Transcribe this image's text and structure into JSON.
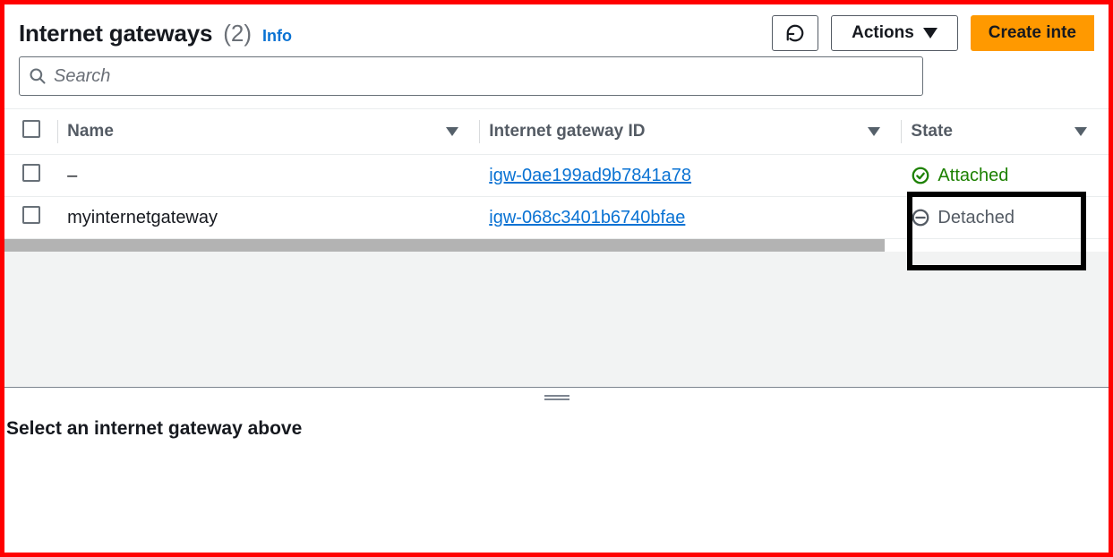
{
  "header": {
    "title": "Internet gateways",
    "count": "(2)",
    "info": "Info",
    "actions": "Actions",
    "create": "Create inte"
  },
  "search": {
    "placeholder": "Search"
  },
  "columns": {
    "name": "Name",
    "id": "Internet gateway ID",
    "state": "State"
  },
  "rows": [
    {
      "name": "–",
      "id": "igw-0ae199ad9b7841a78",
      "state": "Attached",
      "state_kind": "attached"
    },
    {
      "name": "myinternetgateway",
      "id": "igw-068c3401b6740bfae",
      "state": "Detached",
      "state_kind": "detached"
    }
  ],
  "detail": {
    "empty_message": "Select an internet gateway above"
  }
}
